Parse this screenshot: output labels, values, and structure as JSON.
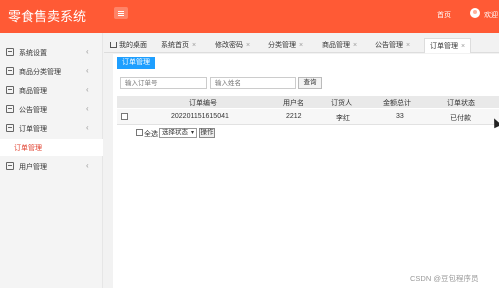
{
  "app": {
    "title": "零食售卖系统"
  },
  "header": {
    "home": "首页",
    "welcome": "欢迎"
  },
  "sidebar": {
    "items": [
      {
        "label": "系统设置"
      },
      {
        "label": "商品分类管理"
      },
      {
        "label": "商品管理"
      },
      {
        "label": "公告管理"
      },
      {
        "label": "订单管理"
      },
      {
        "label": "用户管理"
      }
    ],
    "active_sub": "订单管理"
  },
  "tabs": [
    {
      "label": "我的桌面"
    },
    {
      "label": "系统首页"
    },
    {
      "label": "修改密码"
    },
    {
      "label": "分类管理"
    },
    {
      "label": "商品管理"
    },
    {
      "label": "公告管理"
    },
    {
      "label": "订单管理"
    }
  ],
  "tab_close": "×",
  "section": {
    "title": "订单管理"
  },
  "search": {
    "order_placeholder": "输入订单号",
    "name_placeholder": "输入姓名",
    "query_button": "查询"
  },
  "table": {
    "columns": [
      "订单编号",
      "用户名",
      "订货人",
      "金额总计",
      "订单状态"
    ],
    "rows": [
      {
        "order_no": "202201151615041",
        "username": "2212",
        "buyer": "李红",
        "total": "33",
        "status": "已付款"
      }
    ]
  },
  "footer": {
    "select_all": "全选",
    "status_select": "选择状态",
    "operate_button": "操作"
  },
  "watermark": "CSDN @豆包程序员",
  "colors": {
    "header": "#ff5a35",
    "accent": "#1e9fff",
    "active_sub": "#e03c2a"
  }
}
